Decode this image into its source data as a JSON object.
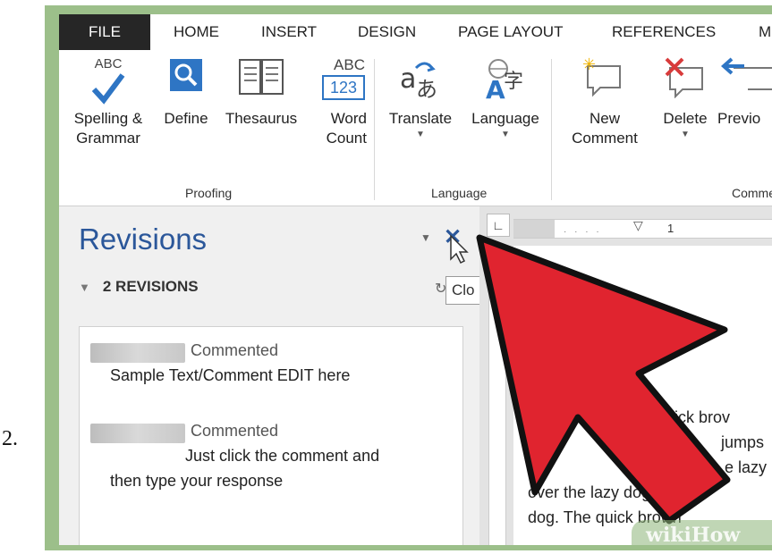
{
  "step_number": "2.",
  "tabs": [
    "FILE",
    "HOME",
    "INSERT",
    "DESIGN",
    "PAGE LAYOUT",
    "REFERENCES",
    "M"
  ],
  "ribbon": {
    "proofing": {
      "label": "Proofing",
      "spelling": {
        "line1": "Spelling &",
        "line2": "Grammar",
        "icon_text": "ABC"
      },
      "define": {
        "label": "Define"
      },
      "thesaurus": {
        "label": "Thesaurus"
      },
      "word_count": {
        "line1": "Word",
        "line2": "Count",
        "icon_top": "ABC",
        "icon_bottom": "123"
      }
    },
    "language": {
      "label": "Language",
      "translate": {
        "label": "Translate"
      },
      "language_btn": {
        "label": "Language"
      }
    },
    "comments": {
      "label": "Comme",
      "new_comment": {
        "line1": "New",
        "line2": "Comment"
      },
      "delete": {
        "label": "Delete"
      },
      "previous": {
        "label": "Previo"
      }
    }
  },
  "revisions_pane": {
    "title": "Revisions",
    "count_label": "2 REVISIONS",
    "close_tooltip": "Clo",
    "comments": [
      {
        "action": "Commented",
        "text": "Sample Text/Comment EDIT here"
      },
      {
        "action": "Commented",
        "line1": "Just click the comment and",
        "line2": "then type your response"
      }
    ]
  },
  "document": {
    "ruler_mark": "1",
    "lines": [
      "uick brov",
      "k bro",
      "jumps",
      "jumps o",
      "e lazy",
      "over the lazy dog. The",
      "dog.  The quick brown"
    ]
  },
  "watermark": "wikiHow",
  "colors": {
    "accent": "#2b579a",
    "arrow_fill": "#e0242f",
    "frame": "#9cbf8a"
  }
}
